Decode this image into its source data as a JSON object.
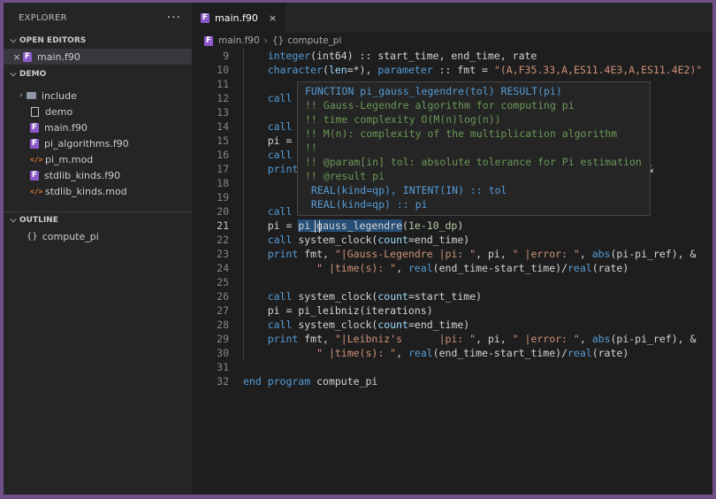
{
  "explorer": {
    "title": "EXPLORER",
    "more_label": "···"
  },
  "open_editors": {
    "title": "OPEN EDITORS",
    "file": "main.f90"
  },
  "demo": {
    "title": "DEMO",
    "items": [
      {
        "label": "include",
        "kind": "folder"
      },
      {
        "label": "demo",
        "kind": "file"
      },
      {
        "label": "main.f90",
        "kind": "fortran"
      },
      {
        "label": "pi_algorithms.f90",
        "kind": "fortran"
      },
      {
        "label": "pi_m.mod",
        "kind": "mod"
      },
      {
        "label": "stdlib_kinds.f90",
        "kind": "fortran"
      },
      {
        "label": "stdlib_kinds.mod",
        "kind": "mod"
      }
    ]
  },
  "outline": {
    "title": "OUTLINE",
    "item": "compute_pi",
    "braces": "{}"
  },
  "tab": {
    "label": "main.f90",
    "close": "×"
  },
  "breadcrumb": {
    "file": "main.f90",
    "symbol": "compute_pi",
    "braces": "{}"
  },
  "icons": {
    "fortran": "fortran-icon",
    "mod": "mod-file-icon",
    "chevron": "chevron-icon",
    "close": "close-icon"
  },
  "colors": {
    "accent": "#8c5ac8",
    "frame": "#6e4f86",
    "selection": "#264f78"
  },
  "line_numbers": [
    "9",
    "10",
    "11",
    "12",
    "13",
    "14",
    "15",
    "16",
    "17",
    "18",
    "19",
    "20",
    "21",
    "22",
    "23",
    "24",
    "25",
    "26",
    "27",
    "28",
    "29",
    "30",
    "31",
    "32"
  ],
  "current_line": "21",
  "hover": {
    "lines": [
      "FUNCTION pi_gauss_legendre(tol) RESULT(pi)",
      "!! Gauss-Legendre algorithm for computing pi",
      "!! time complexity O(M(n)log(n))",
      "!! M(n): complexity of the multiplication algorithm",
      "!!",
      "!! @param[in] tol: absolute tolerance for Pi estimation",
      "!! @result pi",
      " REAL(kind=qp), INTENT(IN) :: tol",
      " REAL(kind=qp) :: pi"
    ]
  }
}
